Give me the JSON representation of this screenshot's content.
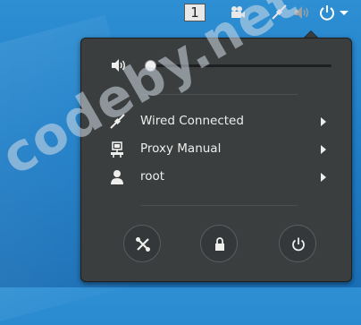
{
  "topbar": {
    "workspace_number": "1",
    "icons": [
      "camera-icon",
      "network-wired-icon",
      "volume-icon",
      "power-icon",
      "chevron-down-icon"
    ]
  },
  "menu": {
    "volume": {
      "icon": "volume-icon",
      "level": 0.0
    },
    "items": [
      {
        "label": "Wired Connected",
        "icon": "network-wired-icon"
      },
      {
        "label": "Proxy Manual",
        "icon": "proxy-icon"
      },
      {
        "label": "root",
        "icon": "user-icon"
      }
    ],
    "buttons": [
      {
        "name": "settings",
        "icon": "settings-icon"
      },
      {
        "name": "lock",
        "icon": "lock-icon"
      },
      {
        "name": "power",
        "icon": "power-icon"
      }
    ]
  },
  "watermark": {
    "text": "codeby.net"
  },
  "colors": {
    "menu_bg": "#3b3e3f",
    "desktop": "#1f7fc8",
    "text": "#eeeeec"
  }
}
